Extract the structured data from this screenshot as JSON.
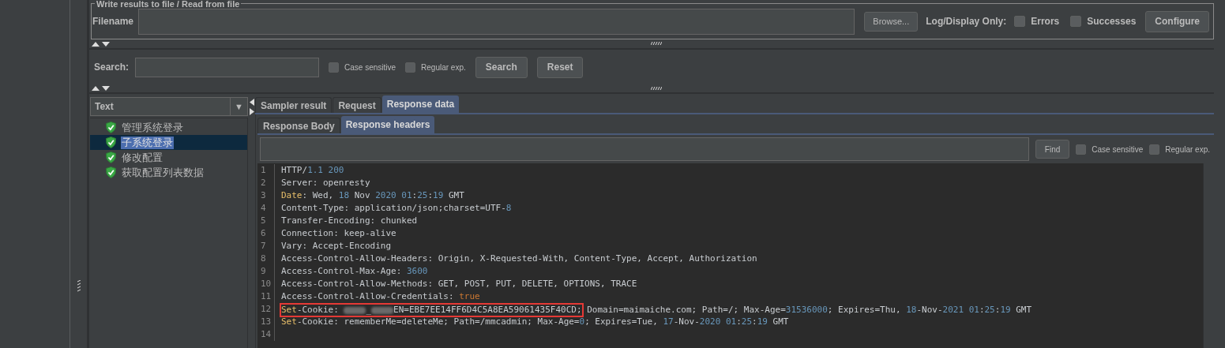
{
  "file_panel": {
    "legend": "Write results to file / Read from file",
    "filename_label": "Filename",
    "browse_button": "Browse...",
    "log_label": "Log/Display Only:",
    "options": [
      {
        "label": "Errors",
        "checked": false
      },
      {
        "label": "Successes",
        "checked": false
      }
    ],
    "configure_button": "Configure"
  },
  "search_bar": {
    "label": "Search:",
    "options": [
      {
        "label": "Case sensitive",
        "checked": false
      },
      {
        "label": "Regular exp.",
        "checked": false
      }
    ],
    "search_button": "Search",
    "reset_button": "Reset"
  },
  "renderer": {
    "value": "Text",
    "arrow": "▼"
  },
  "tree": [
    {
      "label": "管理系统登录",
      "selected": false
    },
    {
      "label": "子系统登录",
      "selected": true
    },
    {
      "label": "修改配置",
      "selected": false
    },
    {
      "label": "获取配置列表数据",
      "selected": false
    }
  ],
  "tabs": [
    {
      "label": "Sampler result",
      "selected": false
    },
    {
      "label": "Request",
      "selected": false
    },
    {
      "label": "Response data",
      "selected": true
    }
  ],
  "subtabs": [
    {
      "label": "Response Body",
      "selected": false
    },
    {
      "label": "Response headers",
      "selected": true
    }
  ],
  "find_bar": {
    "find_button": "Find",
    "options": [
      {
        "label": "Case sensitive",
        "checked": false
      },
      {
        "label": "Regular exp.",
        "checked": false
      }
    ]
  },
  "code_lines": [
    {
      "number": "1",
      "segments": [
        {
          "kind": "text",
          "text": "HTTP/"
        },
        {
          "kind": "number",
          "text": "1.1 200"
        }
      ]
    },
    {
      "number": "2",
      "segments": [
        {
          "kind": "text",
          "text": "Server: openresty"
        }
      ]
    },
    {
      "number": "3",
      "segments": [
        {
          "kind": "key",
          "text": "Date"
        },
        {
          "kind": "text",
          "text": ": Wed, "
        },
        {
          "kind": "number",
          "text": "18"
        },
        {
          "kind": "text",
          "text": " Nov "
        },
        {
          "kind": "number",
          "text": "2020 01"
        },
        {
          "kind": "text",
          "text": ":"
        },
        {
          "kind": "number",
          "text": "25"
        },
        {
          "kind": "text",
          "text": ":"
        },
        {
          "kind": "number",
          "text": "19"
        },
        {
          "kind": "text",
          "text": " GMT"
        }
      ]
    },
    {
      "number": "4",
      "segments": [
        {
          "kind": "text",
          "text": "Content-Type: application/json;charset=UTF-"
        },
        {
          "kind": "number",
          "text": "8"
        }
      ]
    },
    {
      "number": "5",
      "segments": [
        {
          "kind": "text",
          "text": "Transfer-Encoding: chunked"
        }
      ]
    },
    {
      "number": "6",
      "segments": [
        {
          "kind": "text",
          "text": "Connection: keep-alive"
        }
      ]
    },
    {
      "number": "7",
      "segments": [
        {
          "kind": "text",
          "text": "Vary: Accept-Encoding"
        }
      ]
    },
    {
      "number": "8",
      "segments": [
        {
          "kind": "text",
          "text": "Access-Control-Allow-Headers: Origin, X-Requested-With, Content-Type, Accept, Authorization"
        }
      ]
    },
    {
      "number": "9",
      "segments": [
        {
          "kind": "text",
          "text": "Access-Control-Max-Age: "
        },
        {
          "kind": "number",
          "text": "3600"
        }
      ]
    },
    {
      "number": "10",
      "segments": [
        {
          "kind": "text",
          "text": "Access-Control-Allow-Methods: GET, POST, PUT, DELETE, OPTIONS, TRACE"
        }
      ]
    },
    {
      "number": "11",
      "segments": [
        {
          "kind": "text",
          "text": "Access-Control-Allow-Credentials: "
        },
        {
          "kind": "literal",
          "text": "true"
        }
      ]
    },
    {
      "number": "12",
      "segments": [
        {
          "kind": "box",
          "children": [
            {
              "kind": "key",
              "text": "Set"
            },
            {
              "kind": "text",
              "text": "-Cookie: "
            },
            {
              "kind": "redacted"
            },
            {
              "kind": "text",
              "text": "_"
            },
            {
              "kind": "redacted"
            },
            {
              "kind": "text",
              "text": "EN=EBE7EE14FF6D4C5A8EA59061435F40CD;"
            }
          ]
        },
        {
          "kind": "text",
          "text": " Domain=maimaiche.com; Path=/; Max-Age="
        },
        {
          "kind": "number",
          "text": "31536000"
        },
        {
          "kind": "text",
          "text": "; Expires=Thu, "
        },
        {
          "kind": "number",
          "text": "18"
        },
        {
          "kind": "text",
          "text": "-Nov-"
        },
        {
          "kind": "number",
          "text": "2021 01"
        },
        {
          "kind": "text",
          "text": ":"
        },
        {
          "kind": "number",
          "text": "25"
        },
        {
          "kind": "text",
          "text": ":"
        },
        {
          "kind": "number",
          "text": "19"
        },
        {
          "kind": "text",
          "text": " GMT"
        }
      ]
    },
    {
      "number": "13",
      "segments": [
        {
          "kind": "key",
          "text": "Set"
        },
        {
          "kind": "text",
          "text": "-Cookie: rememberMe=deleteMe; Path=/mmcadmin; Max-Age="
        },
        {
          "kind": "number",
          "text": "0"
        },
        {
          "kind": "text",
          "text": "; Expires=Tue, "
        },
        {
          "kind": "number",
          "text": "17"
        },
        {
          "kind": "text",
          "text": "-Nov-"
        },
        {
          "kind": "number",
          "text": "2020 01"
        },
        {
          "kind": "text",
          "text": ":"
        },
        {
          "kind": "number",
          "text": "25"
        },
        {
          "kind": "text",
          "text": ":"
        },
        {
          "kind": "number",
          "text": "19"
        },
        {
          "kind": "text",
          "text": " GMT"
        }
      ]
    },
    {
      "number": "14"
    }
  ]
}
